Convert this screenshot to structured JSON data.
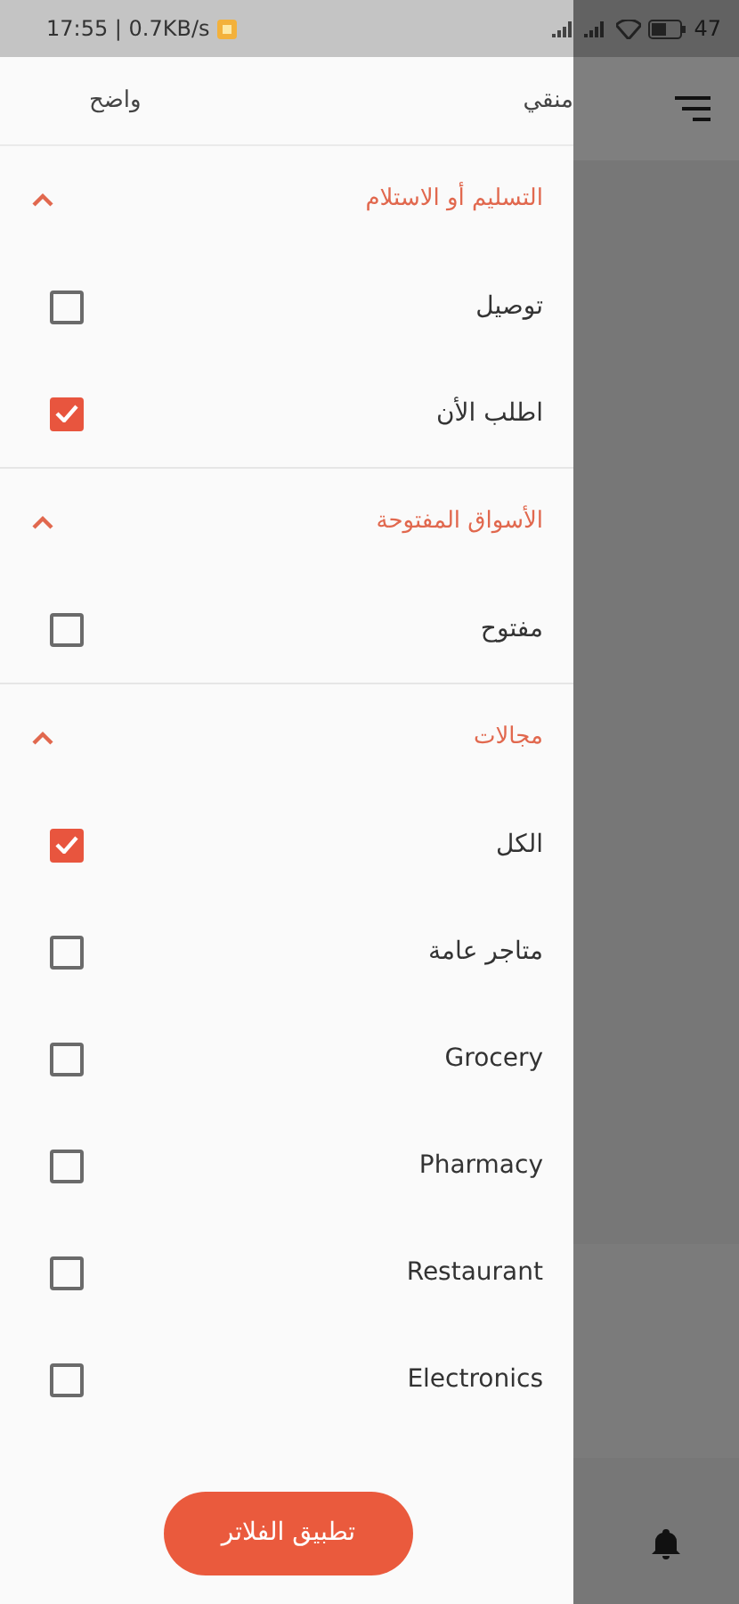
{
  "status_bar": {
    "time_speed": "17:55 | 0.7KB/s",
    "battery": "47"
  },
  "drawer": {
    "header": {
      "clear": "واضح",
      "title": "منقي"
    },
    "sections": [
      {
        "title": "التسليم أو الاستلام",
        "expanded": true,
        "options": [
          {
            "label": "توصيل",
            "checked": false
          },
          {
            "label": "اطلب الأن",
            "checked": true
          }
        ]
      },
      {
        "title": "الأسواق المفتوحة",
        "expanded": true,
        "options": [
          {
            "label": "مفتوح",
            "checked": false
          }
        ]
      },
      {
        "title": "مجالات",
        "expanded": true,
        "options": [
          {
            "label": "الكل",
            "checked": true
          },
          {
            "label": "متاجر عامة",
            "checked": false
          },
          {
            "label": "Grocery",
            "checked": false
          },
          {
            "label": "Pharmacy",
            "checked": false
          },
          {
            "label": "Restaurant",
            "checked": false
          },
          {
            "label": "Electronics",
            "checked": false
          }
        ]
      }
    ],
    "apply_button": "تطبيق الفلاتر"
  }
}
